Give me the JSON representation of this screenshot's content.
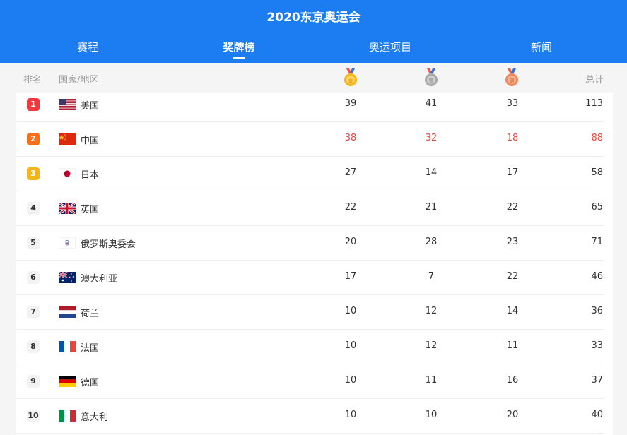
{
  "header": {
    "title": "2020东京奥运会",
    "tabs": [
      {
        "label": "赛程"
      },
      {
        "label": "奖牌榜"
      },
      {
        "label": "奥运项目"
      },
      {
        "label": "新闻"
      }
    ],
    "active_tab": "奖牌榜",
    "bg_color": "#1c7cf2"
  },
  "columns": {
    "rank": "排名",
    "country": "国家/地区",
    "gold_icon": "gold-medal-icon",
    "silver_icon": "silver-medal-icon",
    "bronze_icon": "bronze-medal-icon",
    "total": "总计"
  },
  "rows": [
    {
      "rank": "1",
      "flag": "usa-flag-icon",
      "country": "美国",
      "gold": "39",
      "silver": "41",
      "bronze": "33",
      "total": "113"
    },
    {
      "rank": "2",
      "flag": "china-flag-icon",
      "country": "中国",
      "gold": "38",
      "silver": "32",
      "bronze": "18",
      "total": "88"
    },
    {
      "rank": "3",
      "flag": "japan-flag-icon",
      "country": "日本",
      "gold": "27",
      "silver": "14",
      "bronze": "17",
      "total": "58"
    },
    {
      "rank": "4",
      "flag": "uk-flag-icon",
      "country": "英国",
      "gold": "22",
      "silver": "21",
      "bronze": "22",
      "total": "65"
    },
    {
      "rank": "5",
      "flag": "roc-flag-icon",
      "country": "俄罗斯奥委会",
      "gold": "20",
      "silver": "28",
      "bronze": "23",
      "total": "71"
    },
    {
      "rank": "6",
      "flag": "australia-flag-icon",
      "country": "澳大利亚",
      "gold": "17",
      "silver": "7",
      "bronze": "22",
      "total": "46"
    },
    {
      "rank": "7",
      "flag": "netherlands-flag-icon",
      "country": "荷兰",
      "gold": "10",
      "silver": "12",
      "bronze": "14",
      "total": "36"
    },
    {
      "rank": "8",
      "flag": "france-flag-icon",
      "country": "法国",
      "gold": "10",
      "silver": "12",
      "bronze": "11",
      "total": "33"
    },
    {
      "rank": "9",
      "flag": "germany-flag-icon",
      "country": "德国",
      "gold": "10",
      "silver": "11",
      "bronze": "16",
      "total": "37"
    },
    {
      "rank": "10",
      "flag": "italy-flag-icon",
      "country": "意大利",
      "gold": "10",
      "silver": "10",
      "bronze": "20",
      "total": "40"
    }
  ],
  "highlight_color": "#e8483f"
}
